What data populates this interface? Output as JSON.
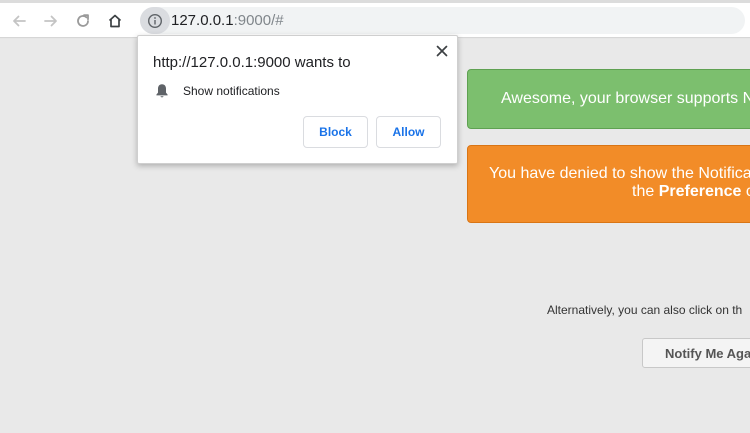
{
  "browser": {
    "back_icon": "arrow-left-icon",
    "forward_icon": "arrow-right-icon",
    "reload_icon": "reload-icon",
    "home_icon": "home-icon",
    "site_info_icon": "info-icon",
    "url_host": "127.0.0.1",
    "url_rest": ":9000/#"
  },
  "permission_popup": {
    "title": "http://127.0.0.1:9000 wants to",
    "permission_icon": "bell-icon",
    "permission_label": "Show notifications",
    "block_label": "Block",
    "allow_label": "Allow",
    "close_icon": "close-icon"
  },
  "page": {
    "success_alert": "Awesome, your browser supports N",
    "warning_alert_line1": "You have denied to show the Notifica",
    "warning_alert_line2_prefix": "the ",
    "warning_alert_line2_bold": "Preference",
    "warning_alert_line2_suffix": " c",
    "alternative_text": "Alternatively, you can also click on th",
    "notify_button": "Notify Me Aga"
  },
  "colors": {
    "success": "#7cbf6e",
    "warning": "#f28c28",
    "link_blue": "#1a73e8"
  }
}
